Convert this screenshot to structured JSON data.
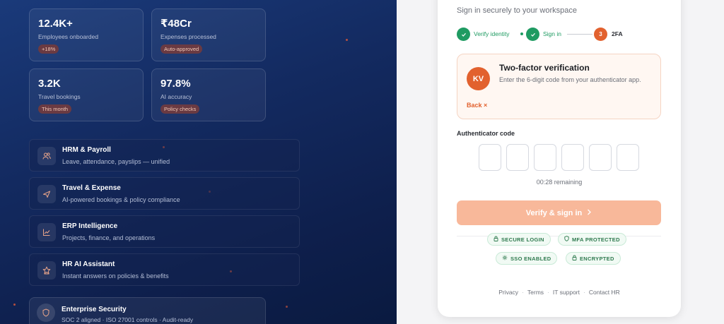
{
  "stats": [
    {
      "value": "12.4K+",
      "label": "Employees onboarded",
      "badge": "+18%"
    },
    {
      "value": "₹48Cr",
      "label": "Expenses processed",
      "badge": "Auto-approved"
    },
    {
      "value": "3.2K",
      "label": "Travel bookings",
      "badge": "This month"
    },
    {
      "value": "97.8%",
      "label": "AI accuracy",
      "badge": "Policy checks"
    }
  ],
  "features": [
    {
      "title": "HRM & Payroll",
      "desc": "Leave, attendance, payslips — unified",
      "icon": "users-icon"
    },
    {
      "title": "Travel & Expense",
      "desc": "AI-powered bookings & policy compliance",
      "icon": "plane-icon"
    },
    {
      "title": "ERP Intelligence",
      "desc": "Projects, finance, and operations",
      "icon": "chart-icon"
    },
    {
      "title": "HR AI Assistant",
      "desc": "Instant answers on policies & benefits",
      "icon": "star-icon"
    }
  ],
  "enterprise": {
    "title": "Enterprise Security",
    "desc": "SOC 2 aligned · ISO 27001 controls · Audit-ready",
    "icon": "shield-icon"
  },
  "auth": {
    "subtitle": "Sign in securely to your workspace",
    "steps": [
      {
        "label": "Verify identity",
        "status": "done"
      },
      {
        "label": "Sign in",
        "status": "done"
      },
      {
        "label": "2FA",
        "number": "3",
        "status": "active"
      }
    ],
    "twofa": {
      "avatar": "KV",
      "title": "Two-factor verification",
      "desc": "Enter the 6-digit code from your authenticator app.",
      "back": "Back ×"
    },
    "code_label": "Authenticator code",
    "remaining": "00:28 remaining",
    "verify_label": "Verify & sign in",
    "chips": [
      "SECURE LOGIN",
      "MFA PROTECTED",
      "SSO ENABLED",
      "ENCRYPTED"
    ],
    "links": [
      "Privacy",
      "Terms",
      "IT support",
      "Contact HR"
    ]
  },
  "colors": {
    "accent": "#e2612e",
    "success": "#1f9b62",
    "panel_bg": "#132a60",
    "verify_bg": "#f8b89a"
  }
}
